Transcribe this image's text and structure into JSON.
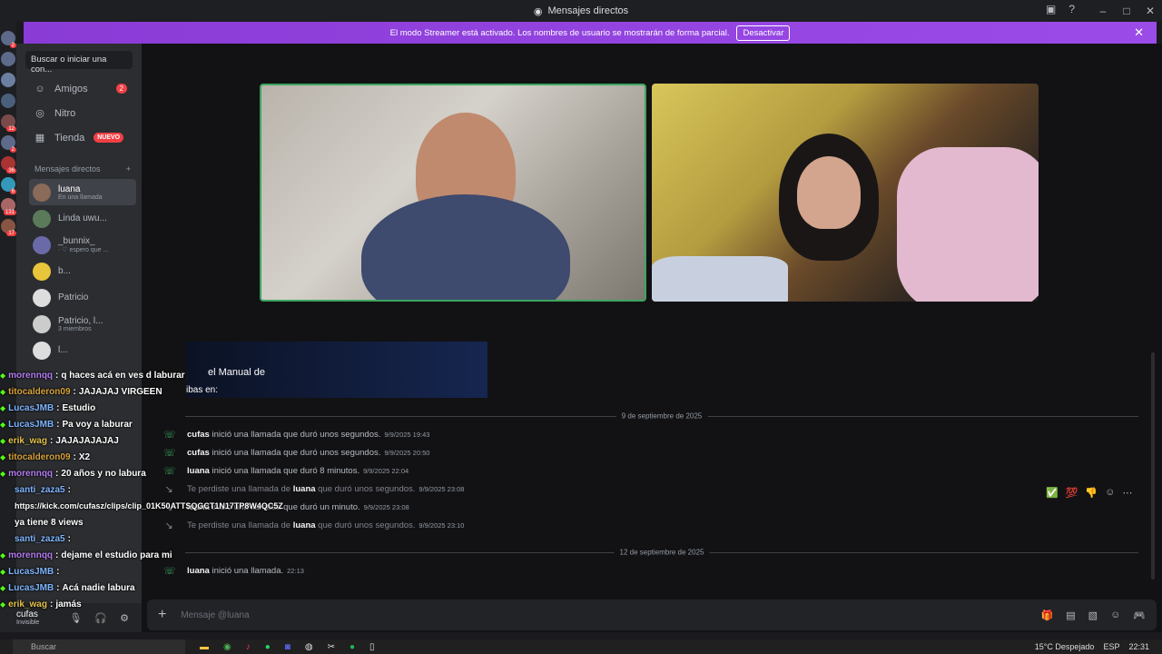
{
  "titlebar": {
    "title": "Mensajes directos"
  },
  "banner": {
    "text": "El modo Streamer está activado. Los nombres de usuario se mostrarán de forma parcial.",
    "button": "Desactivar"
  },
  "sidebar": {
    "search_placeholder": "Buscar o iniciar una con...",
    "nav": [
      {
        "label": "Amigos",
        "badge": "2"
      },
      {
        "label": "Nitro"
      },
      {
        "label": "Tienda",
        "tag": "NUEVO"
      }
    ],
    "dm_header": "Mensajes directos",
    "dms": [
      {
        "name": "luana",
        "sub": "En una llamada"
      },
      {
        "name": "Linda uwu...",
        "sub": ""
      },
      {
        "name": "_bunnix_",
        "sub": "· ♡ espero que ..."
      },
      {
        "name": "b...",
        "sub": ""
      },
      {
        "name": "Patricio",
        "sub": ""
      },
      {
        "name": "Patricio, l...",
        "sub": "3 miembros"
      },
      {
        "name": "l...",
        "sub": ""
      }
    ]
  },
  "guild_badges": [
    "2",
    "12",
    "2",
    "36",
    "6",
    "131",
    "17"
  ],
  "overlay_card": {
    "line1": "el Manual de",
    "line2": "ibas en:"
  },
  "messages": {
    "divider1": "9 de septiembre de 2025",
    "divider2": "12 de septiembre de 2025",
    "rows": [
      {
        "user": "cufas",
        "text": "inició una llamada que duró unos segundos.",
        "ts": "9/9/2025 19:43",
        "missed": false
      },
      {
        "user": "cufas",
        "text": "inició una llamada que duró unos segundos.",
        "ts": "9/9/2025 20:50",
        "missed": false
      },
      {
        "user": "luana",
        "text": "inició una llamada que duró 8 minutos.",
        "ts": "9/9/2025 22:04",
        "missed": false
      },
      {
        "pre": "Te perdiste una llamada de",
        "user": "luana",
        "text": "que duró unos segundos.",
        "ts": "9/9/2025 23:08",
        "missed": true
      },
      {
        "user": "luana",
        "text": "inició una llamada que duró un minuto.",
        "ts": "9/9/2025 23:08",
        "missed": false
      },
      {
        "pre": "Te perdiste una llamada de",
        "user": "luana",
        "text": "que duró unos segundos.",
        "ts": "9/9/2025 23:10",
        "missed": true
      },
      {
        "user": "luana",
        "text": "inició una llamada.",
        "ts": "22:13",
        "missed": false
      }
    ]
  },
  "composer": {
    "placeholder": "Mensaje @luana"
  },
  "user": {
    "name": "cufas",
    "status": "Invisible"
  },
  "chat": [
    {
      "user": "morennqq",
      "color": "#b57cf2",
      "text": "q haces acá en ves d laburar"
    },
    {
      "user": "titocalderon09",
      "color": "#d8a33c",
      "text": "JAJAJAJ VIRGEEN"
    },
    {
      "user": "LucasJMB",
      "color": "#7fb5ff",
      "text": "Estudio"
    },
    {
      "user": "LucasJMB",
      "color": "#7fb5ff",
      "text": "Pa voy a laburar"
    },
    {
      "user": "erik_wag",
      "color": "#e6c34a",
      "text": "JAJAJAJAJAJ"
    },
    {
      "user": "titocalderon09",
      "color": "#d8a33c",
      "text": "X2"
    },
    {
      "user": "morennqq",
      "color": "#b57cf2",
      "text": "20 años y no labura"
    },
    {
      "user": "santi_zaza5",
      "color": "#7fb5ff",
      "text": ""
    },
    {
      "user": "",
      "color": "#ffffff",
      "text": "https://kick.com/cufasz/clips/clip_01K50ATTSQGCT1N17TP8W4QC5Z"
    },
    {
      "user": "",
      "color": "#ffffff",
      "text": "ya tiene 8 views"
    },
    {
      "user": "santi_zaza5",
      "color": "#7fb5ff",
      "text": ""
    },
    {
      "user": "morennqq",
      "color": "#b57cf2",
      "text": "dejame el estudio para mi"
    },
    {
      "user": "LucasJMB",
      "color": "#7fb5ff",
      "text": ""
    },
    {
      "user": "LucasJMB",
      "color": "#7fb5ff",
      "text": "Acá nadie labura"
    },
    {
      "user": "erik_wag",
      "color": "#e6c34a",
      "text": "jamás"
    }
  ],
  "taskbar": {
    "search": "Buscar",
    "weather": "15°C Despejado",
    "lang": "ESP",
    "time": "22:31"
  }
}
